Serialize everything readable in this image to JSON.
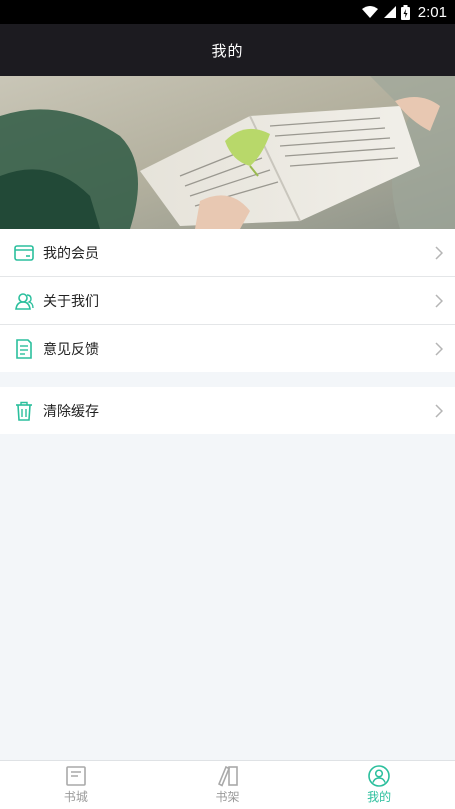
{
  "status": {
    "time": "2:01"
  },
  "header": {
    "title": "我的"
  },
  "menu": {
    "group1": [
      {
        "label": "我的会员",
        "icon": "member-card-icon"
      },
      {
        "label": "关于我们",
        "icon": "users-icon"
      },
      {
        "label": "意见反馈",
        "icon": "feedback-icon"
      }
    ],
    "group2": [
      {
        "label": "清除缓存",
        "icon": "trash-icon"
      }
    ]
  },
  "tabs": [
    {
      "label": "书城",
      "icon": "bookstore-icon",
      "active": false
    },
    {
      "label": "书架",
      "icon": "bookshelf-icon",
      "active": false
    },
    {
      "label": "我的",
      "icon": "profile-icon",
      "active": true
    }
  ],
  "colors": {
    "accent": "#2bbf9d",
    "inactive": "#9a9a9a",
    "header_bg": "#1c1b20",
    "page_bg": "#f3f6f9"
  }
}
